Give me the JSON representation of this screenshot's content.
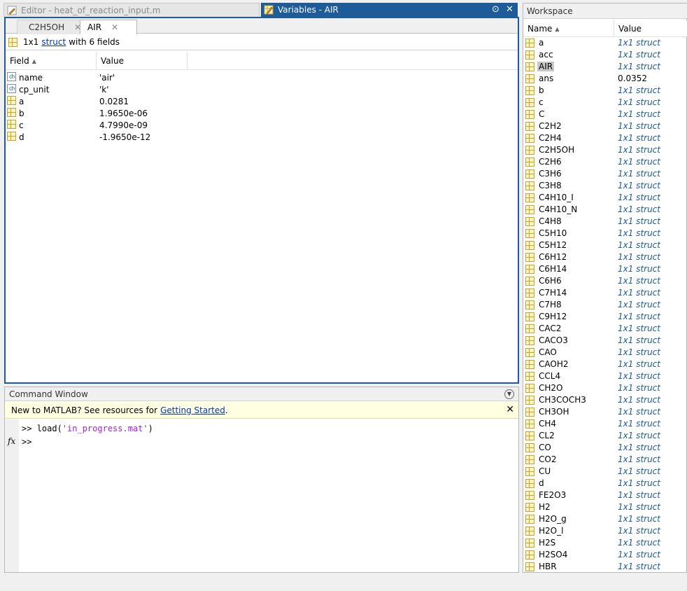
{
  "tabs": {
    "editor": "Editor - heat_of_reaction_input.m",
    "variables": "Variables - AIR"
  },
  "variables_panel": {
    "sub_tabs": [
      "C2H5OH",
      "AIR"
    ],
    "info_prefix": "1x1",
    "info_link": "struct",
    "info_suffix": "with 6 fields",
    "columns": {
      "field": "Field",
      "value": "Value"
    },
    "fields": [
      {
        "name": "name",
        "value": "'air'",
        "kind": "char"
      },
      {
        "name": "cp_unit",
        "value": "'k'",
        "kind": "char"
      },
      {
        "name": "a",
        "value": "0.0281",
        "kind": "num"
      },
      {
        "name": "b",
        "value": "1.9650e-06",
        "kind": "num"
      },
      {
        "name": "c",
        "value": "4.7990e-09",
        "kind": "num"
      },
      {
        "name": "d",
        "value": "-1.9650e-12",
        "kind": "num"
      }
    ]
  },
  "command_window": {
    "title": "Command Window",
    "banner_text": "New to MATLAB? See resources for",
    "banner_link": "Getting Started",
    "banner_end": ".",
    "prompt": ">>",
    "cmd_prefix": "load(",
    "cmd_string": "'in_progress.mat'",
    "cmd_suffix": ")",
    "fx_label": "fx"
  },
  "workspace": {
    "title": "Workspace",
    "columns": {
      "name": "Name",
      "value": "Value"
    },
    "selected": "AIR",
    "items": [
      {
        "name": "a",
        "value": "1x1 struct"
      },
      {
        "name": "acc",
        "value": "1x1 struct"
      },
      {
        "name": "AIR",
        "value": "1x1 struct"
      },
      {
        "name": "ans",
        "value": "0.0352"
      },
      {
        "name": "b",
        "value": "1x1 struct"
      },
      {
        "name": "c",
        "value": "1x1 struct"
      },
      {
        "name": "C",
        "value": "1x1 struct"
      },
      {
        "name": "C2H2",
        "value": "1x1 struct"
      },
      {
        "name": "C2H4",
        "value": "1x1 struct"
      },
      {
        "name": "C2H5OH",
        "value": "1x1 struct"
      },
      {
        "name": "C2H6",
        "value": "1x1 struct"
      },
      {
        "name": "C3H6",
        "value": "1x1 struct"
      },
      {
        "name": "C3H8",
        "value": "1x1 struct"
      },
      {
        "name": "C4H10_I",
        "value": "1x1 struct"
      },
      {
        "name": "C4H10_N",
        "value": "1x1 struct"
      },
      {
        "name": "C4H8",
        "value": "1x1 struct"
      },
      {
        "name": "C5H10",
        "value": "1x1 struct"
      },
      {
        "name": "C5H12",
        "value": "1x1 struct"
      },
      {
        "name": "C6H12",
        "value": "1x1 struct"
      },
      {
        "name": "C6H14",
        "value": "1x1 struct"
      },
      {
        "name": "C6H6",
        "value": "1x1 struct"
      },
      {
        "name": "C7H14",
        "value": "1x1 struct"
      },
      {
        "name": "C7H8",
        "value": "1x1 struct"
      },
      {
        "name": "C9H12",
        "value": "1x1 struct"
      },
      {
        "name": "CAC2",
        "value": "1x1 struct"
      },
      {
        "name": "CACO3",
        "value": "1x1 struct"
      },
      {
        "name": "CAO",
        "value": "1x1 struct"
      },
      {
        "name": "CAOH2",
        "value": "1x1 struct"
      },
      {
        "name": "CCL4",
        "value": "1x1 struct"
      },
      {
        "name": "CH2O",
        "value": "1x1 struct"
      },
      {
        "name": "CH3COCH3",
        "value": "1x1 struct"
      },
      {
        "name": "CH3OH",
        "value": "1x1 struct"
      },
      {
        "name": "CH4",
        "value": "1x1 struct"
      },
      {
        "name": "CL2",
        "value": "1x1 struct"
      },
      {
        "name": "CO",
        "value": "1x1 struct"
      },
      {
        "name": "CO2",
        "value": "1x1 struct"
      },
      {
        "name": "CU",
        "value": "1x1 struct"
      },
      {
        "name": "d",
        "value": "1x1 struct"
      },
      {
        "name": "FE2O3",
        "value": "1x1 struct"
      },
      {
        "name": "H2",
        "value": "1x1 struct"
      },
      {
        "name": "H2O_g",
        "value": "1x1 struct"
      },
      {
        "name": "H2O_l",
        "value": "1x1 struct"
      },
      {
        "name": "H2S",
        "value": "1x1 struct"
      },
      {
        "name": "H2SO4",
        "value": "1x1 struct"
      },
      {
        "name": "HBR",
        "value": "1x1 struct"
      }
    ]
  },
  "colors": {
    "accent": "#1e5b99",
    "banner": "#ffffe1",
    "string": "#a020f0"
  }
}
